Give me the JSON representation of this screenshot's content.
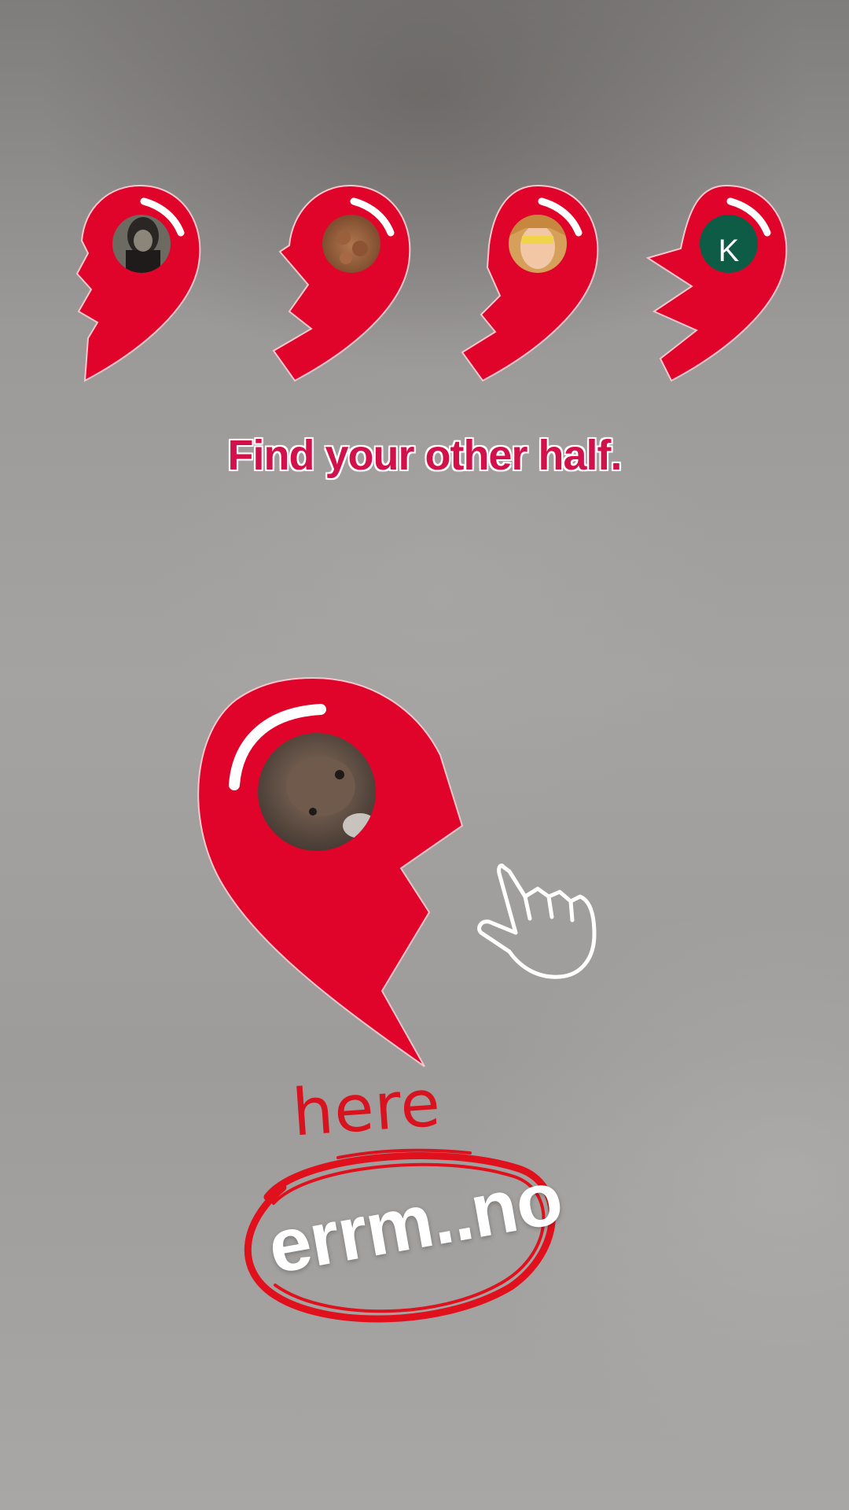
{
  "headline": "Find your other half.",
  "annotation": {
    "here": "here",
    "errm": "errm..no"
  },
  "pieces": [
    {
      "avatar": "anime-character-photo"
    },
    {
      "avatar": "brown-dog-photo"
    },
    {
      "avatar": "masked-hero-illustration"
    },
    {
      "avatar": "letter-initial",
      "initial": "K"
    }
  ],
  "main_piece": {
    "avatar": "cat-photo"
  },
  "colors": {
    "heart_red": "#e0042a",
    "headline": "#d0114a",
    "avatar_k_bg": "#0f5c46",
    "annotation_red": "#d8131f"
  },
  "icons": [
    "tap-hand-icon"
  ]
}
